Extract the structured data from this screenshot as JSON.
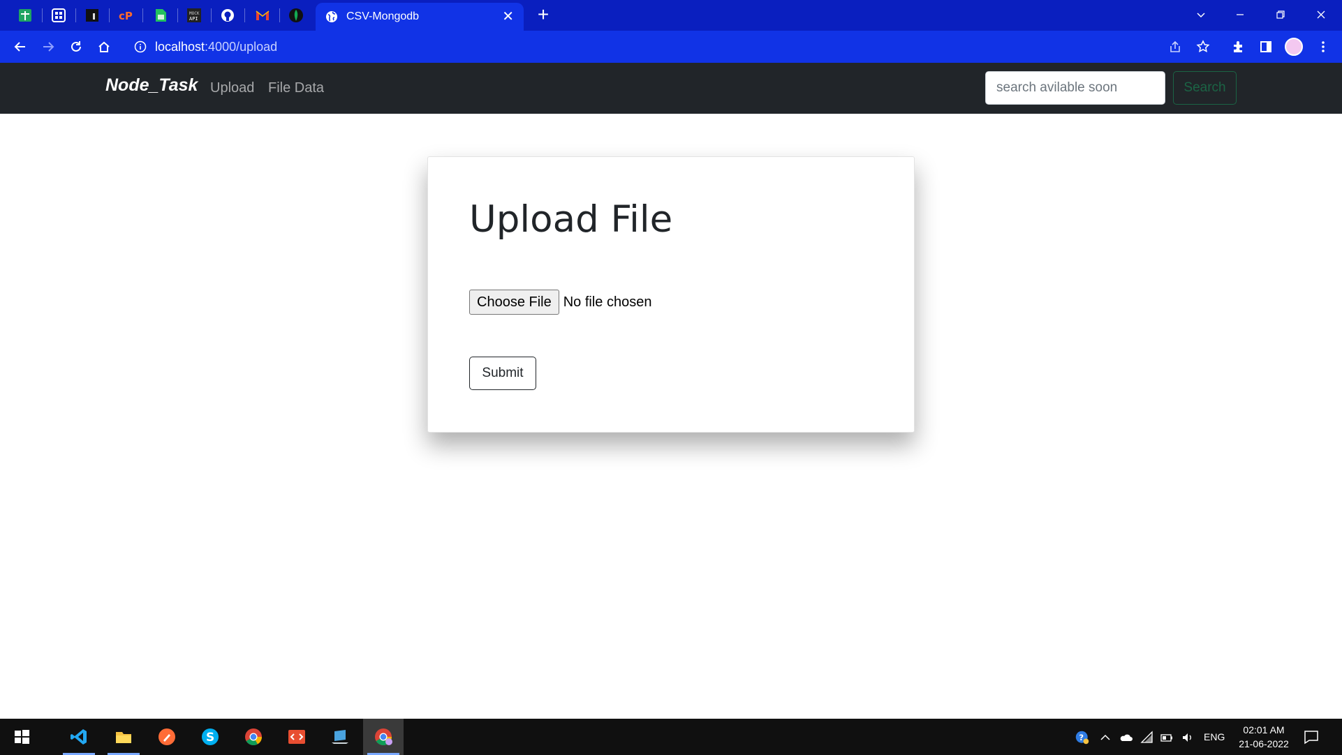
{
  "browser": {
    "tab_title": "CSV-Mongodb",
    "tab_close": "✕",
    "new_tab": "+",
    "url_host": "localhost",
    "url_path": ":4000/upload",
    "pinned_tabs": [
      "sheets-icon",
      "grid-app-icon",
      "dark-app-icon",
      "cp-icon",
      "sheets-icon",
      "mock-api-icon",
      "github-icon",
      "gmail-icon",
      "mongodb-icon"
    ]
  },
  "site": {
    "brand": "Node_Task",
    "nav": {
      "upload": "Upload",
      "file_data": "File Data"
    },
    "search": {
      "placeholder": "search avilable soon",
      "button": "Search"
    }
  },
  "upload_card": {
    "title": "Upload File",
    "choose_file": "Choose File",
    "no_file": "No file chosen",
    "submit": "Submit"
  },
  "taskbar": {
    "apps": [
      "vscode-icon",
      "file-explorer-icon",
      "postman-icon",
      "skype-icon",
      "chrome-icon",
      "git-icon",
      "laptop-app-icon",
      "chrome-profile-icon"
    ],
    "language": "ENG",
    "time": "02:01 AM",
    "date": "21-06-2022"
  },
  "colors": {
    "tabstrip": "#0a1fbf",
    "toolbar": "#1133e6",
    "navbar": "#212529",
    "search_button": "#198754",
    "taskbar": "#101010"
  }
}
